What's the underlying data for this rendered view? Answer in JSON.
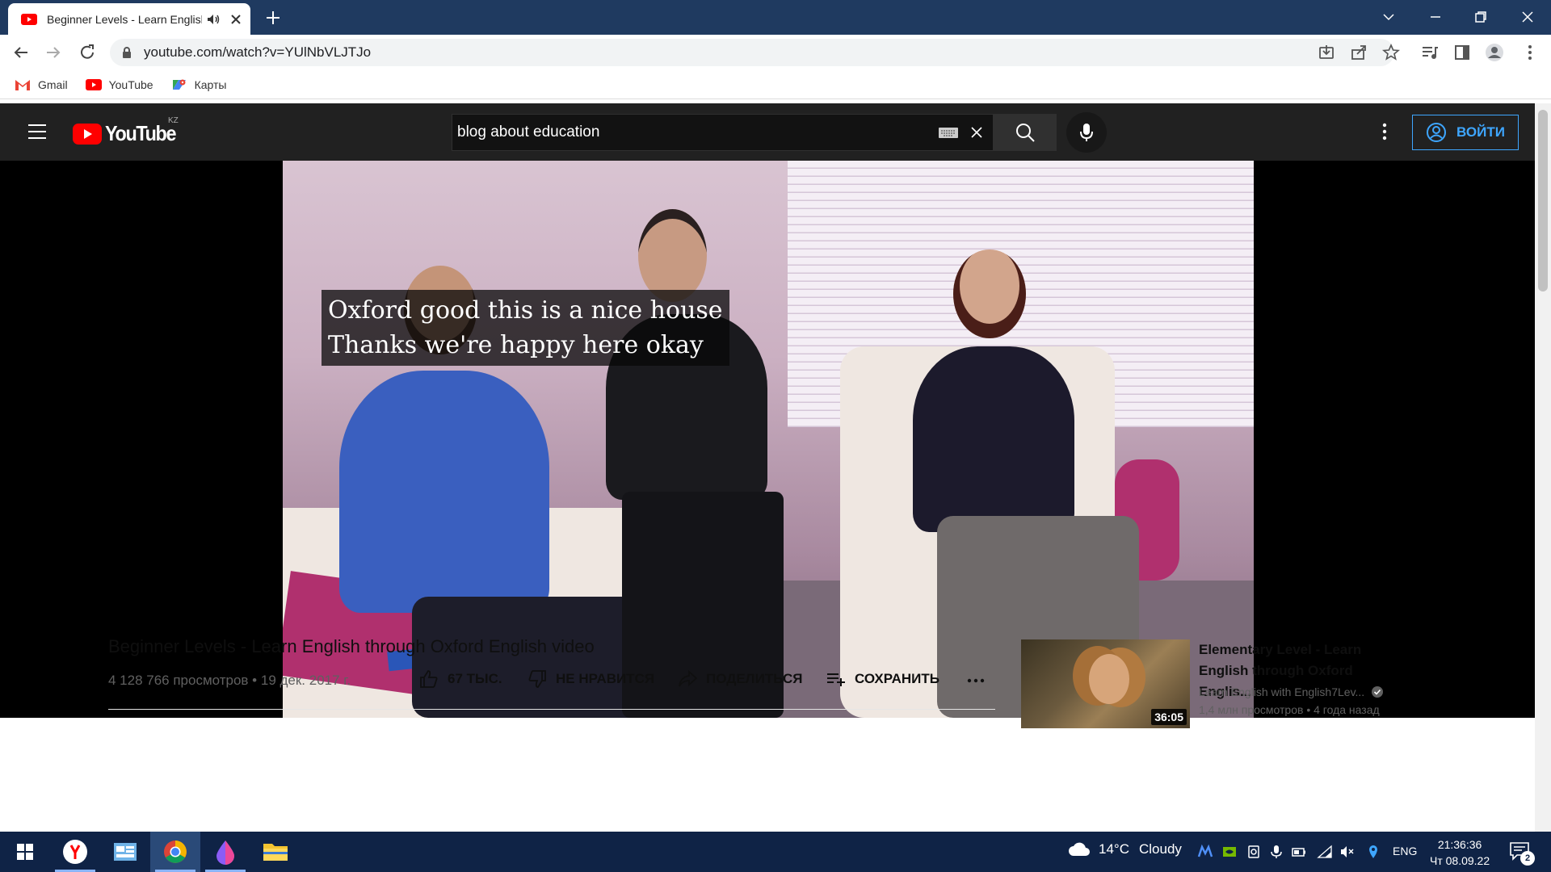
{
  "browser": {
    "tab": {
      "title": "Beginner Levels - Learn English"
    },
    "url": "youtube.com/watch?v=YUlNbVLJTJo",
    "bookmarks": [
      {
        "label": "Gmail",
        "icon": "gmail-icon"
      },
      {
        "label": "YouTube",
        "icon": "youtube-icon"
      },
      {
        "label": "Карты",
        "icon": "maps-icon"
      }
    ]
  },
  "youtube": {
    "logo_region": "KZ",
    "search": {
      "query": "blog about education"
    },
    "signin_label": "ВОЙТИ",
    "captions": [
      "Oxford good this is a nice house",
      "Thanks we're happy here okay"
    ],
    "video": {
      "title": "Beginner Levels - Learn English through Oxford English video",
      "meta": "4 128 766 просмотров • 19 дек. 2017 г.",
      "like_label": "67 ТЫС.",
      "dislike_label": "НЕ НРАВИТСЯ",
      "share_label": "ПОДЕЛИТЬСЯ",
      "save_label": "СОХРАНИТЬ"
    },
    "recommendation": {
      "title": "Elementary Level - Learn English through Oxford Englis...",
      "channel": "Learn English with English7Lev...",
      "meta": "1,4 млн просмотров • 4 года назад",
      "duration": "36:05"
    }
  },
  "taskbar": {
    "weather": {
      "temp": "14°C",
      "condition": "Cloudy"
    },
    "lang": "ENG",
    "time": "21:36:36",
    "date": "Чт 08.09.22",
    "notifications": "2"
  },
  "colors": {
    "yt_red": "#ff0000",
    "yt_dark": "#212121",
    "yt_blue": "#3ea6ff",
    "tab_strip": "#1f3a60",
    "taskbar": "#0f2346"
  }
}
